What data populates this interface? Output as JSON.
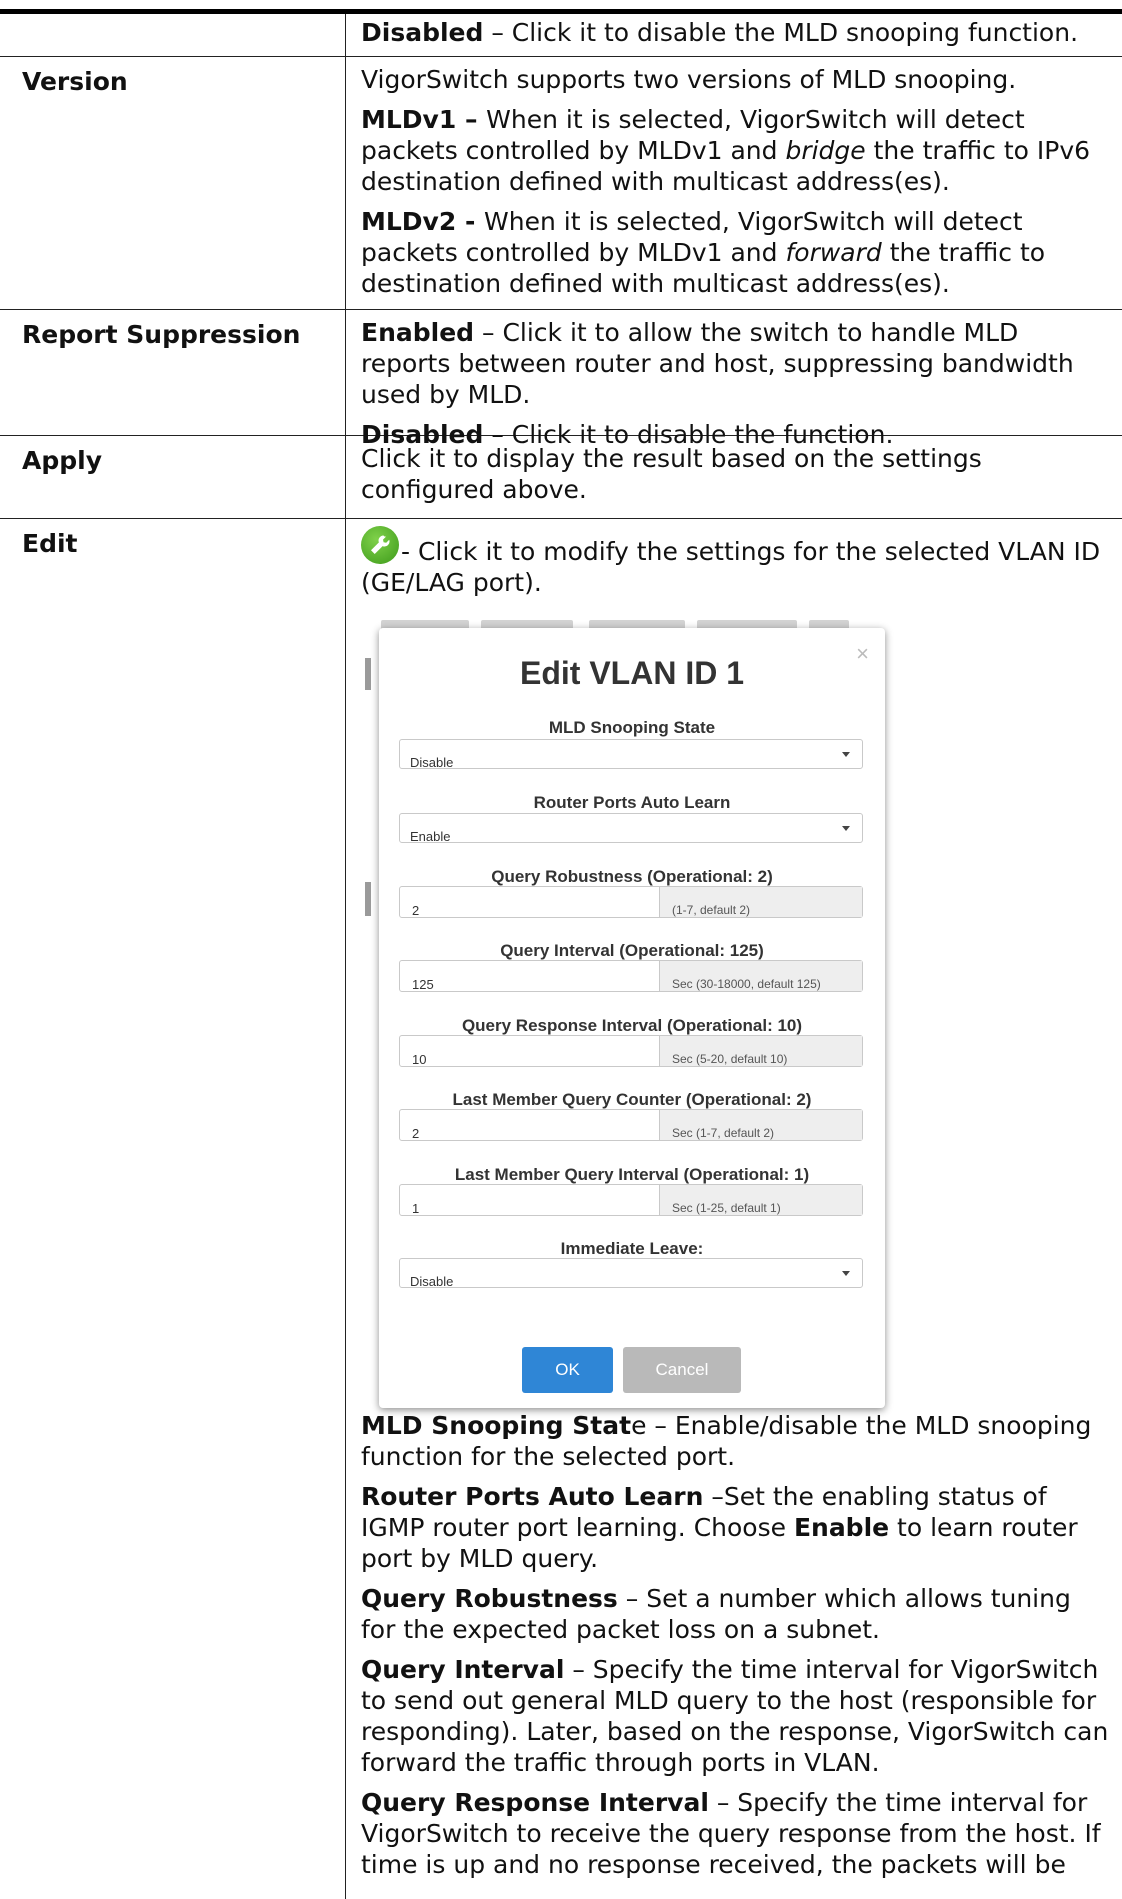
{
  "rows": {
    "disabled_cont": {
      "label": "",
      "text": [
        "Disabled",
        " – Click it to disable the MLD snooping function."
      ]
    },
    "version": {
      "label": "Version",
      "intro": "VigorSwitch supports two versions of MLD snooping.",
      "v1": [
        "MLDv1 – ",
        "When it is selected, VigorSwitch will detect packets controlled by MLDv1 and ",
        "bridge",
        " the traffic to IPv6 destination defined with multicast address(es)."
      ],
      "v2": [
        "MLDv2 - ",
        "When it is selected, VigorSwitch will detect packets controlled by MLDv1 and ",
        "forward",
        " the traffic to destination defined with multicast address(es)."
      ]
    },
    "report": {
      "label": "Report Suppression",
      "enabled": [
        "Enabled",
        " – Click it to allow the switch to handle MLD reports between router and host, suppressing bandwidth used by MLD."
      ],
      "disabled": [
        "Disabled",
        " – Click it to disable the function."
      ]
    },
    "apply": {
      "label": "Apply",
      "text": "Click it to display the result based on the settings configured above."
    },
    "edit": {
      "label": "Edit",
      "icon": "wrench-icon",
      "text": "- Click it to modify the settings for the selected VLAN ID (GE/LAG port).",
      "desc": {
        "state": [
          "MLD Snooping Stat",
          "e",
          " – Enable/disable the MLD snooping function for the selected port."
        ],
        "autolearn": [
          "Router Ports Auto Learn",
          " –Set the enabling status of IGMP router port learning. Choose ",
          "Enable",
          " to learn router port by MLD query."
        ],
        "robustness": [
          "Query Robustness",
          " – Set a number which allows tuning for the expected packet loss on a subnet."
        ],
        "interval": [
          "Query Interval",
          " – Specify the time interval for VigorSwitch to send out general MLD query to the host (responsible for responding). Later, based on the response, VigorSwitch can forward the traffic through ports in VLAN."
        ],
        "response": [
          "Query Response Interval",
          " – Specify the time interval for VigorSwitch to receive the query response from the host. If time is up and no response received, the packets will be"
        ]
      }
    }
  },
  "dialog": {
    "title": "Edit VLAN ID 1",
    "close": "×",
    "fields": {
      "state": {
        "label": "MLD Snooping State",
        "value": "Disable"
      },
      "autolearn": {
        "label": "Router Ports Auto Learn",
        "value": "Enable"
      },
      "robust": {
        "label": "Query Robustness (Operational: 2)",
        "value": "2",
        "hint": "(1-7, default 2)"
      },
      "qint": {
        "label": "Query Interval (Operational: 125)",
        "value": "125",
        "hint": "Sec (30-18000, default 125)"
      },
      "qresp": {
        "label": "Query Response Interval (Operational: 10)",
        "value": "10",
        "hint": "Sec (5-20, default 10)"
      },
      "lmqc": {
        "label": "Last Member Query Counter (Operational: 2)",
        "value": "2",
        "hint": "Sec (1-7, default 2)"
      },
      "lmqi": {
        "label": "Last Member Query Interval (Operational: 1)",
        "value": "1",
        "hint": "Sec (1-25, default 1)"
      },
      "leave": {
        "label": "Immediate Leave:",
        "value": "Disable"
      }
    },
    "ok_label": "OK",
    "cancel_label": "Cancel"
  }
}
